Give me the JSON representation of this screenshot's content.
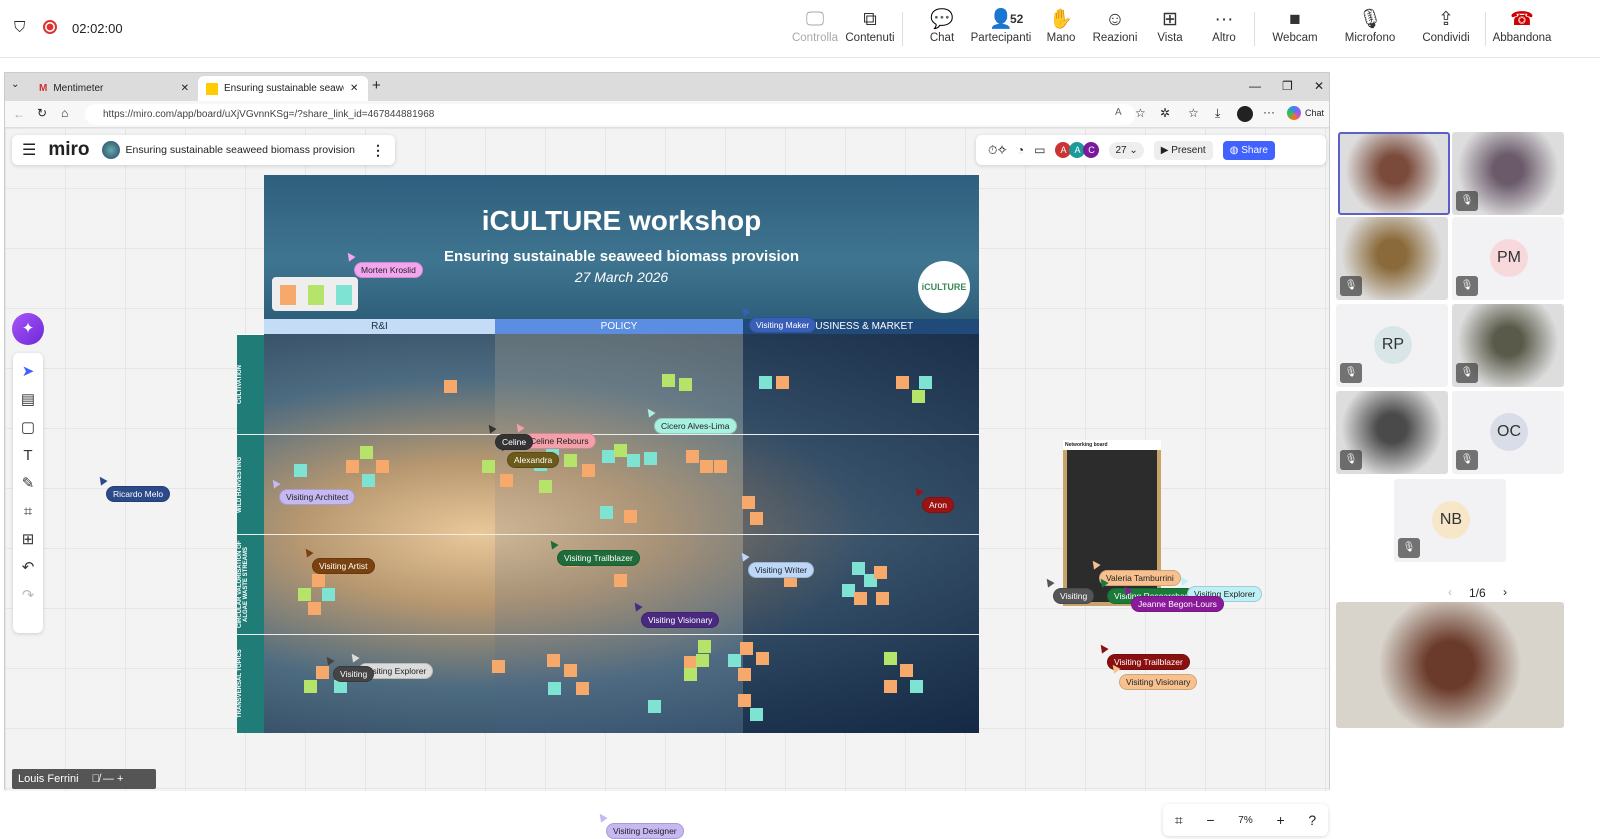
{
  "meeting": {
    "timer": "02:02:00",
    "participants_count": "52",
    "buttons": [
      {
        "label": "Controlla",
        "icon": "screen-control-icon",
        "glyph": "🖵"
      },
      {
        "label": "Contenuti",
        "icon": "share-content-icon",
        "glyph": "⧉"
      },
      {
        "label": "Chat",
        "icon": "chat-icon",
        "glyph": "💬"
      },
      {
        "label": "Partecipanti",
        "icon": "participants-icon",
        "glyph": "👤"
      },
      {
        "label": "Mano",
        "icon": "hand-icon",
        "glyph": "✋"
      },
      {
        "label": "Reazioni",
        "icon": "smile-icon",
        "glyph": "☺"
      },
      {
        "label": "Vista",
        "icon": "grid-icon",
        "glyph": "⊞"
      },
      {
        "label": "Altro",
        "icon": "more-icon",
        "glyph": "···"
      },
      {
        "label": "Webcam",
        "icon": "camera-icon",
        "glyph": "■"
      },
      {
        "label": "Microfono",
        "icon": "mic-off-icon",
        "glyph": "🎙"
      },
      {
        "label": "Condividi",
        "icon": "share-icon",
        "glyph": "⇪"
      },
      {
        "label": "Abbandona",
        "icon": "hangup-icon",
        "glyph": "☎"
      }
    ]
  },
  "browser": {
    "tabs": [
      {
        "title": "Mentimeter"
      },
      {
        "title": "Ensuring sustainable seaweed bio"
      }
    ],
    "url": "https://miro.com/app/board/uXjVGvnnKSg=/?share_link_id=467844881968",
    "chat_label": "Chat"
  },
  "miro": {
    "logo": "miro",
    "board_name": "Ensuring sustainable seaweed biomass provision",
    "online_count": "27",
    "avatars": [
      "A",
      "A",
      "C"
    ],
    "present_label": "Present",
    "share_label": "Share",
    "zoom": "7%"
  },
  "board": {
    "title": "iCULTURE workshop",
    "subtitle": "Ensuring sustainable seaweed biomass provision",
    "date": "27 March 2026",
    "logo_text": "iCULTURE",
    "columns": [
      "R&I",
      "POLICY",
      "BUSINESS & MARKET"
    ],
    "rows": [
      "CULTIVATION",
      "WILD HARVESTING",
      "CIRCULAR VALORISATION OF ALGAE WASTE STREAMS",
      "TRANSVERSAL TOPICS"
    ],
    "networking_title": "Networking board"
  },
  "cursors": [
    "Morten Kroslid",
    "Visiting Maker",
    "Celine Rebours",
    "Cicero Alves-Lima",
    "Alexandra",
    "Ricardo Melo",
    "Visiting Architect",
    "Aron",
    "Visiting Artist",
    "Visiting Trailblazer",
    "Visiting Writer",
    "Visiting Visionary",
    "Visiting Explorer",
    "Visiting Designer",
    "Valeria Tamburrini",
    "Visiting Researcher",
    "Visiting Explorer",
    "Jeanne Begon-Lours",
    "Visiting Trailblazer",
    "Visiting Visionary",
    "Celine",
    "Visiting",
    "Visiting"
  ],
  "user_label": "Louis Ferrini",
  "participants": {
    "initials": [
      "PM",
      "RP",
      "OC",
      "NB"
    ],
    "page": "1/6"
  }
}
